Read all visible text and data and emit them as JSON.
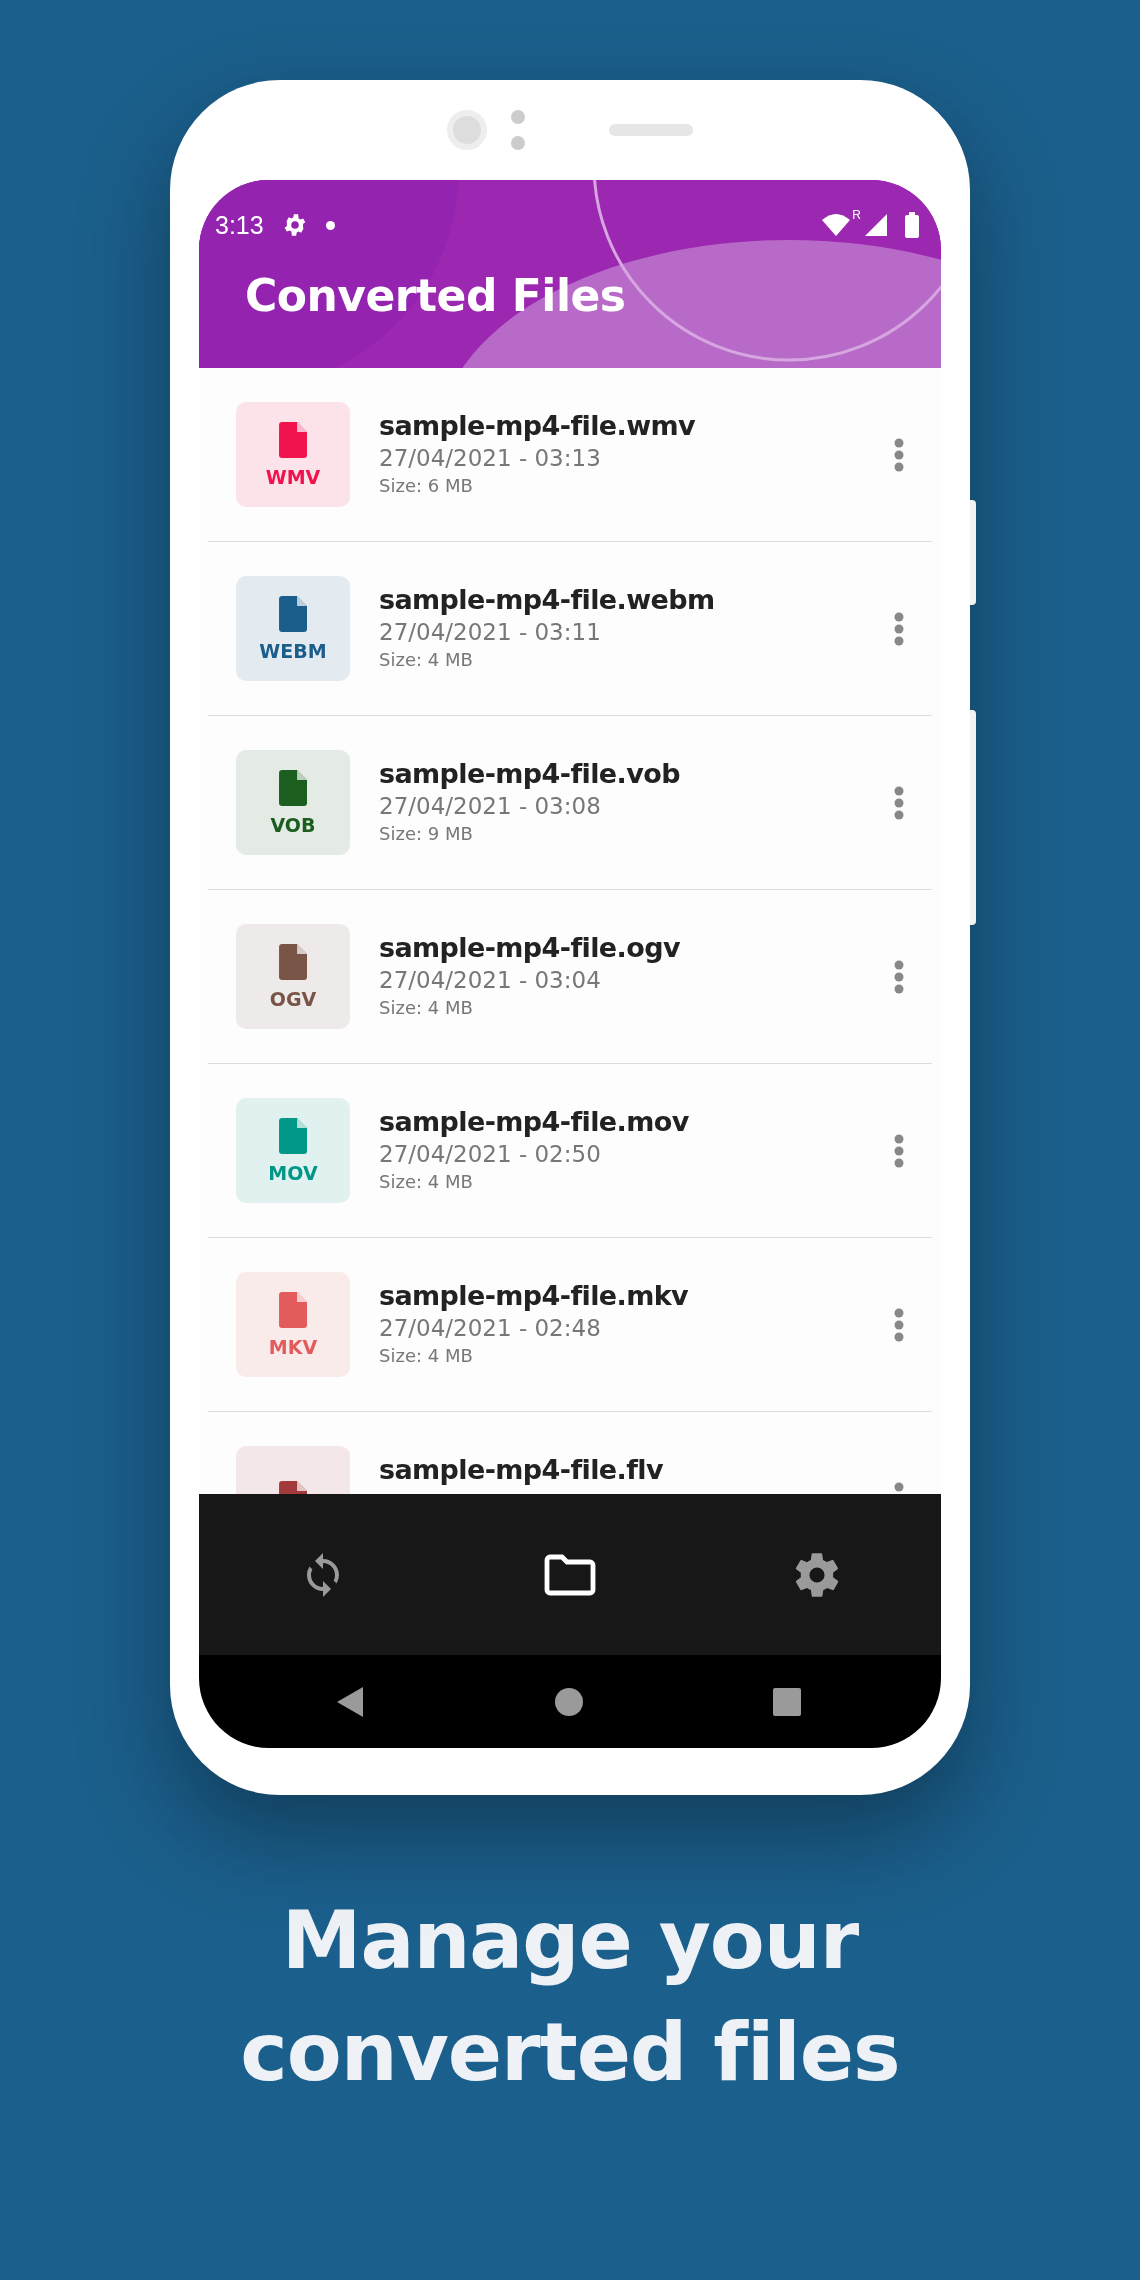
{
  "status_bar": {
    "time": "3:13",
    "roaming": "R"
  },
  "header": {
    "title": "Converted Files"
  },
  "files": [
    {
      "ext": "WMV",
      "name": "sample-mp4-file.wmv",
      "date": "27/04/2021 - 03:13",
      "size": "Size: 6 MB",
      "color": "#f0134d"
    },
    {
      "ext": "WEBM",
      "name": "sample-mp4-file.webm",
      "date": "27/04/2021 - 03:11",
      "size": "Size: 4 MB",
      "color": "#1b5e8c"
    },
    {
      "ext": "VOB",
      "name": "sample-mp4-file.vob",
      "date": "27/04/2021 - 03:08",
      "size": "Size: 9 MB",
      "color": "#1b5e20"
    },
    {
      "ext": "OGV",
      "name": "sample-mp4-file.ogv",
      "date": "27/04/2021 - 03:04",
      "size": "Size: 4 MB",
      "color": "#795548"
    },
    {
      "ext": "MOV",
      "name": "sample-mp4-file.mov",
      "date": "27/04/2021 - 02:50",
      "size": "Size: 4 MB",
      "color": "#009688"
    },
    {
      "ext": "MKV",
      "name": "sample-mp4-file.mkv",
      "date": "27/04/2021 - 02:48",
      "size": "Size: 4 MB",
      "color": "#e35b5b"
    },
    {
      "name": "sample-mp4-file.flv",
      "color": "#a33a3a"
    }
  ],
  "bottom_nav": [
    {
      "kind": "sync",
      "selected": false
    },
    {
      "kind": "folder",
      "selected": true
    },
    {
      "kind": "settings",
      "selected": false
    }
  ],
  "tagline": "Manage your converted files"
}
